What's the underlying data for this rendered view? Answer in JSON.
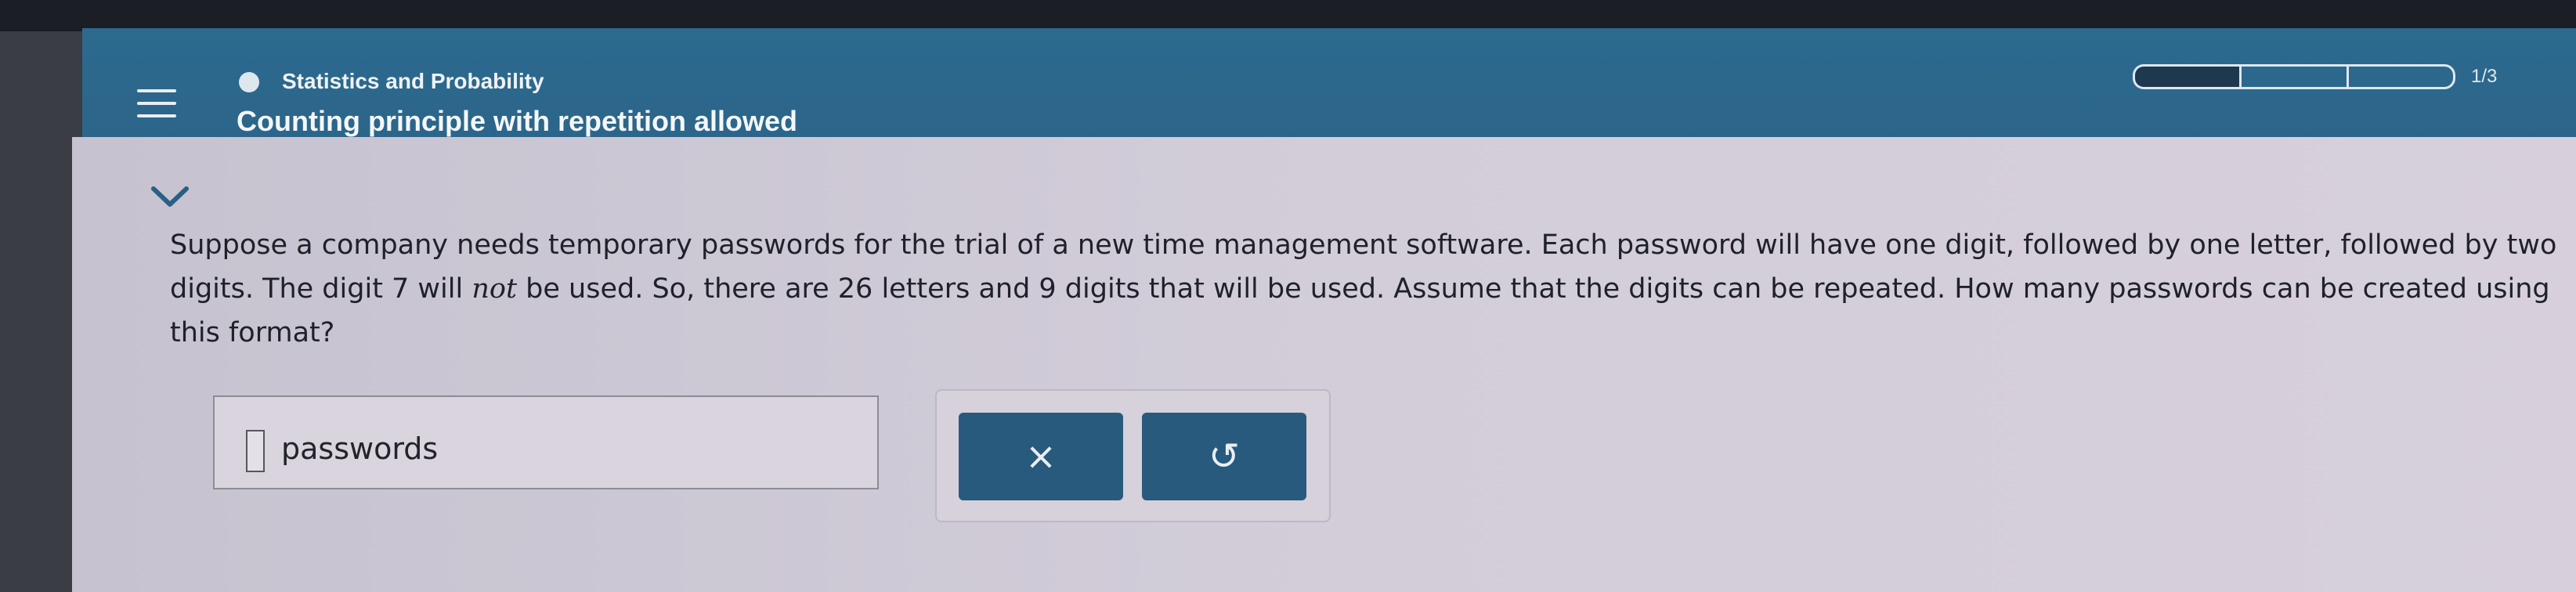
{
  "header": {
    "subject": "Statistics and Probability",
    "lesson_title": "Counting principle with repetition allowed",
    "progress_text": "1/3",
    "progress_filled": 1,
    "progress_total": 3
  },
  "question": {
    "part1": "Suppose a company needs temporary passwords for the trial of a new time management software. Each password will have one digit, followed by one letter, followed by two digits. The digit 7 will ",
    "emphasis": "not",
    "part2": " be used. So, there are 26 letters and 9 digits that will be used. Assume that the digits can be repeated. How many passwords can be created using this format?"
  },
  "answer": {
    "value": "",
    "unit_label": "passwords"
  },
  "buttons": {
    "clear_glyph": "×",
    "undo_glyph": "↺"
  },
  "icons": {
    "menu": "hamburger-menu-icon",
    "topic": "topic-dot-icon",
    "collapse": "chevron-down-icon",
    "clear": "close-icon",
    "undo": "undo-icon"
  },
  "colors": {
    "header_bg": "#2b6488",
    "button_bg": "#285a7e",
    "page_bg": "#d2cdd9"
  }
}
